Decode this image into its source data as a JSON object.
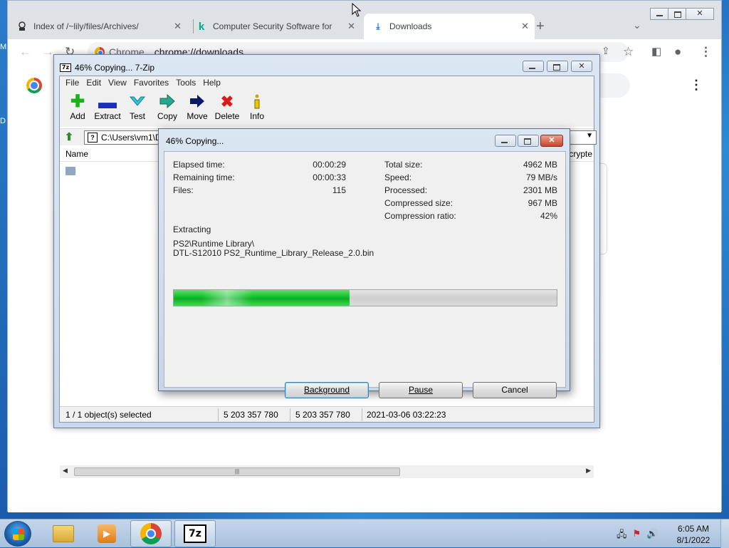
{
  "desktop": {
    "letters": [
      "M",
      "D"
    ]
  },
  "chrome": {
    "tabs": [
      {
        "title": "Index of /~lily/files/Archives/",
        "icon": "server-icon"
      },
      {
        "title": "Computer Security Software for",
        "icon": "kaspersky-k-icon"
      },
      {
        "title": "Downloads",
        "icon": "download-icon"
      }
    ],
    "address": {
      "chip": "Chrome",
      "url": "chrome://downloads"
    }
  },
  "zip": {
    "title": "46% Copying... 7-Zip",
    "menu": [
      "File",
      "Edit",
      "View",
      "Favorites",
      "Tools",
      "Help"
    ],
    "toolbar": [
      {
        "label": "Add",
        "icon": "plus-icon",
        "color": "#19b319"
      },
      {
        "label": "Extract",
        "icon": "minus-icon",
        "color": "#1a2fb8"
      },
      {
        "label": "Test",
        "icon": "check-chevron-icon",
        "color": "#1fb8c8"
      },
      {
        "label": "Copy",
        "icon": "double-arrow-icon",
        "color": "#1f8f7a"
      },
      {
        "label": "Move",
        "icon": "arrow-right-icon",
        "color": "#0a1a66"
      },
      {
        "label": "Delete",
        "icon": "x-icon",
        "color": "#d81b1b"
      },
      {
        "label": "Info",
        "icon": "info-icon",
        "color": "#c7a800"
      }
    ],
    "address": "C:\\Users\\vm1\\D",
    "columns": {
      "name": "Name",
      "encrypted": "Encrypte"
    },
    "status": {
      "selected": "1 / 1 object(s) selected",
      "size1": "5 203 357 780",
      "size2": "5 203 357 780",
      "date": "2021-03-06 03:22:23"
    }
  },
  "dialog": {
    "title": "46% Copying...",
    "left_stats": [
      {
        "label": "Elapsed time:",
        "value": "00:00:29"
      },
      {
        "label": "Remaining time:",
        "value": "00:00:33"
      },
      {
        "label": "Files:",
        "value": "115"
      }
    ],
    "right_stats": [
      {
        "label": "Total size:",
        "value": "4962 MB"
      },
      {
        "label": "Speed:",
        "value": "79 MB/s"
      },
      {
        "label": "Processed:",
        "value": "2301 MB"
      },
      {
        "label": "Compressed size:",
        "value": "967 MB"
      },
      {
        "label": "Compression ratio:",
        "value": "42%"
      }
    ],
    "operation": "Extracting",
    "path_line1": "PS2\\Runtime Library\\",
    "path_line2": "DTL-S12010 PS2_Runtime_Library_Release_2.0.bin",
    "progress_percent": 46,
    "buttons": {
      "background": "Background",
      "pause": "Pause",
      "cancel": "Cancel"
    }
  },
  "taskbar": {
    "items": [
      "explorer",
      "media-player",
      "chrome",
      "7-zip"
    ],
    "clock_time": "6:05 AM",
    "clock_date": "8/1/2022"
  }
}
